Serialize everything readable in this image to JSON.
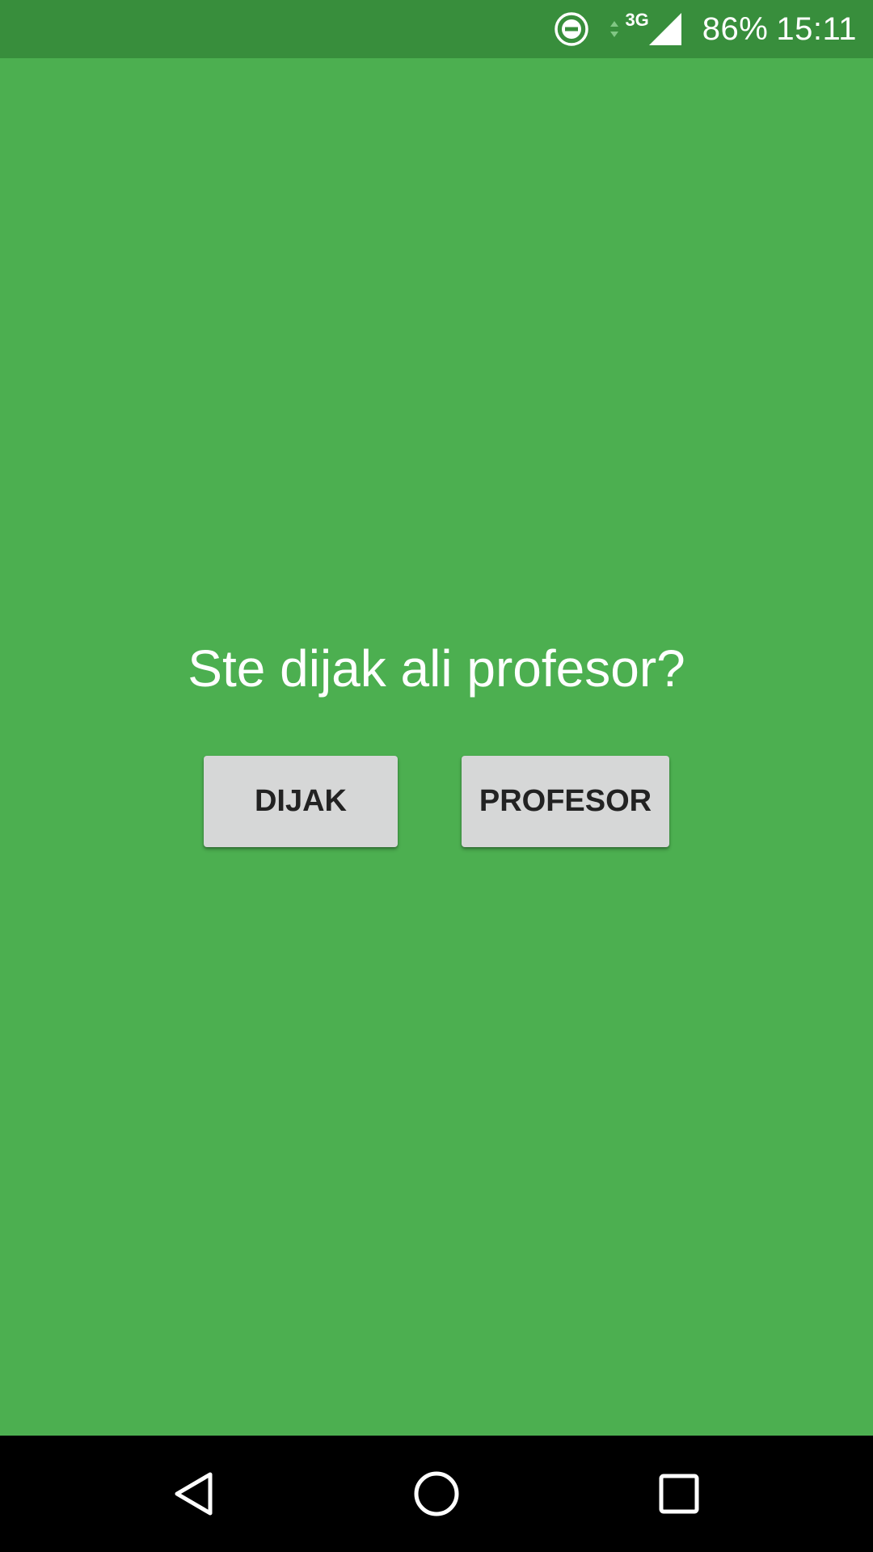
{
  "status_bar": {
    "network_type": "3G",
    "battery_percent": "86%",
    "time": "15:11",
    "icons": [
      "do-not-disturb-icon",
      "data-arrows-icon",
      "signal-icon"
    ],
    "background_color": "#388e3c"
  },
  "main": {
    "background_color": "#4caf50",
    "question": "Ste dijak ali profesor?",
    "buttons": {
      "dijak_label": "DIJAK",
      "profesor_label": "PROFESOR"
    }
  },
  "nav_bar": {
    "icons": [
      "back-icon",
      "home-icon",
      "recents-icon"
    ],
    "background_color": "#000000"
  }
}
